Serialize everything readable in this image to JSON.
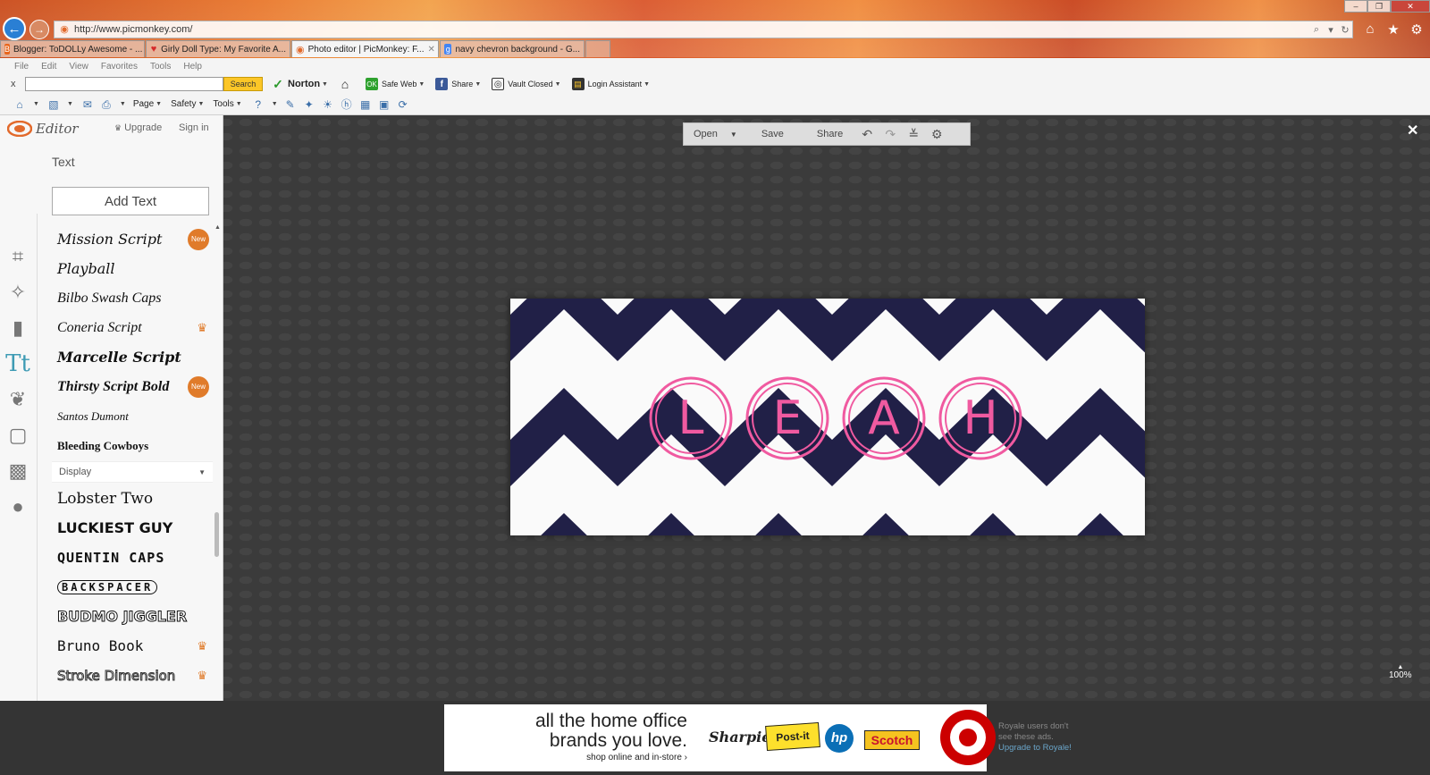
{
  "browser": {
    "url": "http://www.picmonkey.com/",
    "tabs": [
      {
        "label": "Blogger: ToDOLLy Awesome - ...",
        "icon": "blogger-icon",
        "color": "#e8651b"
      },
      {
        "label": "Girly Doll Type: My Favorite A...",
        "icon": "heart-icon",
        "color": "#d62b2b"
      },
      {
        "label": "Photo editor | PicMonkey: F...",
        "icon": "picmonkey-icon",
        "color": "#e26a2c",
        "active": true
      },
      {
        "label": "navy chevron background - G...",
        "icon": "google-icon",
        "color": "#4285f4"
      }
    ],
    "menu": [
      "File",
      "Edit",
      "View",
      "Favorites",
      "Tools",
      "Help"
    ],
    "norton_bar": {
      "search_button": "Search",
      "norton_label": "Norton",
      "safe_web": "Safe Web",
      "share": "Share",
      "vault": "Vault Closed",
      "login_assistant": "Login Assistant"
    },
    "command_bar": {
      "page": "Page",
      "safety": "Safety",
      "tools": "Tools"
    }
  },
  "app": {
    "title": "Editor",
    "upgrade": "Upgrade",
    "sign_in": "Sign in",
    "panel_title": "Text",
    "add_text": "Add Text",
    "fonts": [
      {
        "name": "Mission Script",
        "badge": "New",
        "font": "serif-italic"
      },
      {
        "name": "Playball",
        "badge": "",
        "font": "serif-italic"
      },
      {
        "name": "Bilbo Swash Caps",
        "badge": "",
        "font": "serif-italic"
      },
      {
        "name": "Coneria Script",
        "badge": "crown",
        "font": "serif-italic"
      },
      {
        "name": "Marcelle Script",
        "badge": "",
        "font": "serif-bold-italic"
      },
      {
        "name": "Thirsty Script Bold",
        "badge": "New",
        "font": "serif-bold-italic"
      },
      {
        "name": "Santos Dumont",
        "badge": "",
        "font": "serif-italic"
      },
      {
        "name": "Bleeding Cowboys",
        "badge": "",
        "font": "serif-bold"
      }
    ],
    "category": "Display",
    "display_fonts": [
      {
        "name": "Lobster Two",
        "badge": "",
        "font": "serif"
      },
      {
        "name": "LUCKIEST GUY",
        "badge": "",
        "font": "sans-bold"
      },
      {
        "name": "QUENTIN CAPS",
        "badge": "",
        "font": "mono-bold"
      },
      {
        "name": "BACKSPACER",
        "badge": "",
        "font": "circled"
      },
      {
        "name": "BUDMO JIGGLER",
        "badge": "",
        "font": "sans-bold"
      },
      {
        "name": "Bruno Book",
        "badge": "crown",
        "font": "mono"
      },
      {
        "name": "Stroke Dimension",
        "badge": "crown",
        "font": "sans"
      }
    ],
    "toolbar": {
      "open": "Open",
      "save": "Save",
      "share": "Share"
    },
    "zoom": "100%",
    "canvas": {
      "letters": [
        "L",
        "E",
        "A",
        "H"
      ],
      "chevron_color": "#212047",
      "background_color": "#fafafa",
      "accent_color": "#f05aa0"
    }
  },
  "ad": {
    "line1": "all the home office",
    "line2": "brands you love.",
    "line3": "shop online and in-store",
    "brands": [
      "Sharpie",
      "Post-it",
      "hp",
      "Scotch"
    ],
    "royale_note_1": "Royale users don't",
    "royale_note_2": "see these ads.",
    "royale_link": "Upgrade to Royale!"
  }
}
